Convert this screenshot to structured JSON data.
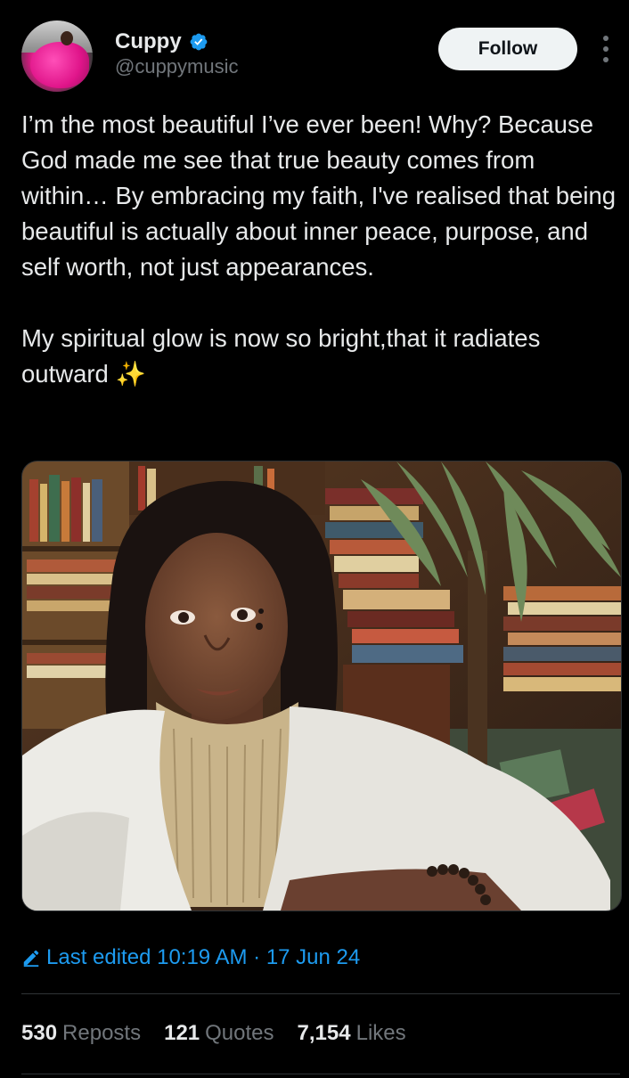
{
  "author": {
    "name": "Cuppy",
    "handle": "@cuppymusic",
    "verified": true
  },
  "actions": {
    "follow_label": "Follow"
  },
  "tweet": {
    "text": "I’m the most beautiful I’ve ever been! Why? Because God made me see that true beauty comes from within… By embracing my faith, I've realised that being beautiful is actually about inner peace, purpose, and self worth, not just appearances.\n\nMy spiritual glow is now so bright,that it radiates outward ✨"
  },
  "meta": {
    "edited_text": "Last edited 10:19 AM · 17 Jun 24"
  },
  "stats": [
    {
      "count": "530",
      "label": "Reposts"
    },
    {
      "count": "121",
      "label": "Quotes"
    },
    {
      "count": "7,154",
      "label": "Likes"
    }
  ],
  "colors": {
    "accent": "#1d9bf0",
    "muted": "#71767b",
    "text": "#e7e9ea",
    "background": "#000000"
  },
  "icons": [
    "verified-badge-icon",
    "more-options-icon",
    "pencil-edit-icon"
  ]
}
